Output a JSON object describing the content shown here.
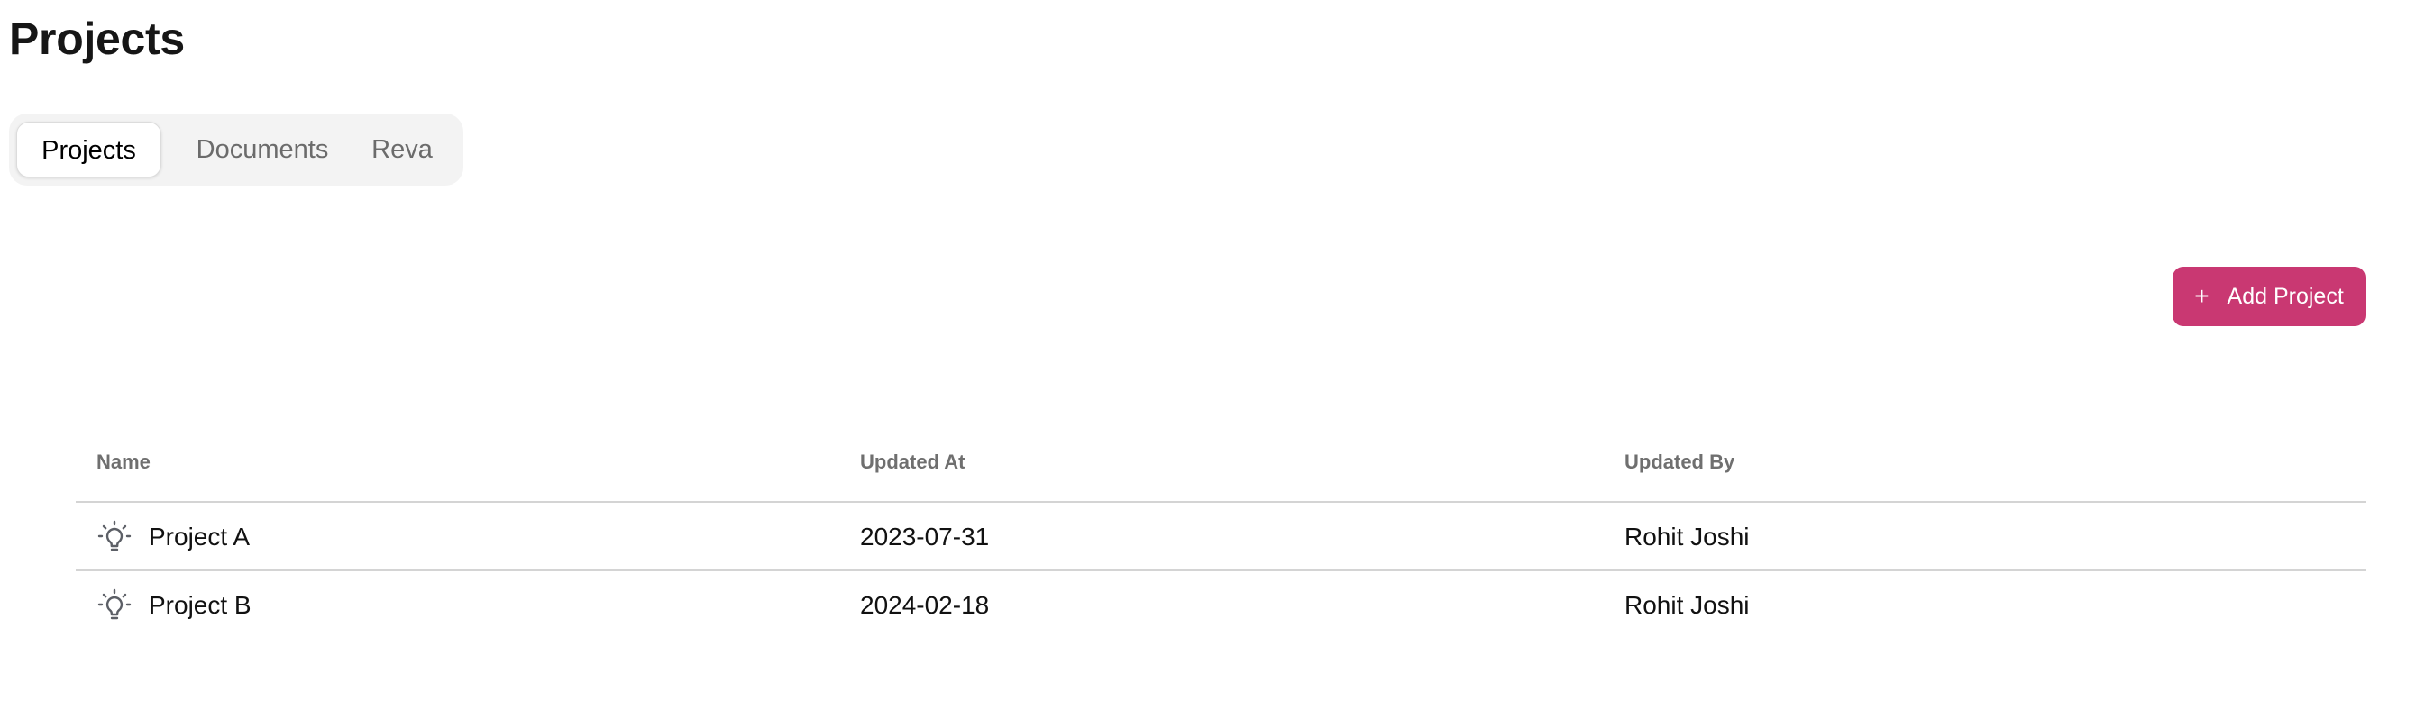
{
  "page": {
    "title": "Projects"
  },
  "tabs": [
    {
      "label": "Projects",
      "active": true
    },
    {
      "label": "Documents",
      "active": false
    },
    {
      "label": "Reva",
      "active": false
    }
  ],
  "toolbar": {
    "add_label": "Add Project",
    "add_icon": "plus-icon",
    "accent_color": "#c93872"
  },
  "table": {
    "columns": [
      "Name",
      "Updated At",
      "Updated By"
    ],
    "rows": [
      {
        "icon": "lightbulb-icon",
        "name": "Project A",
        "updated_at": "2023-07-31",
        "updated_by": "Rohit Joshi"
      },
      {
        "icon": "lightbulb-icon",
        "name": "Project B",
        "updated_at": "2024-02-18",
        "updated_by": "Rohit Joshi"
      }
    ]
  }
}
